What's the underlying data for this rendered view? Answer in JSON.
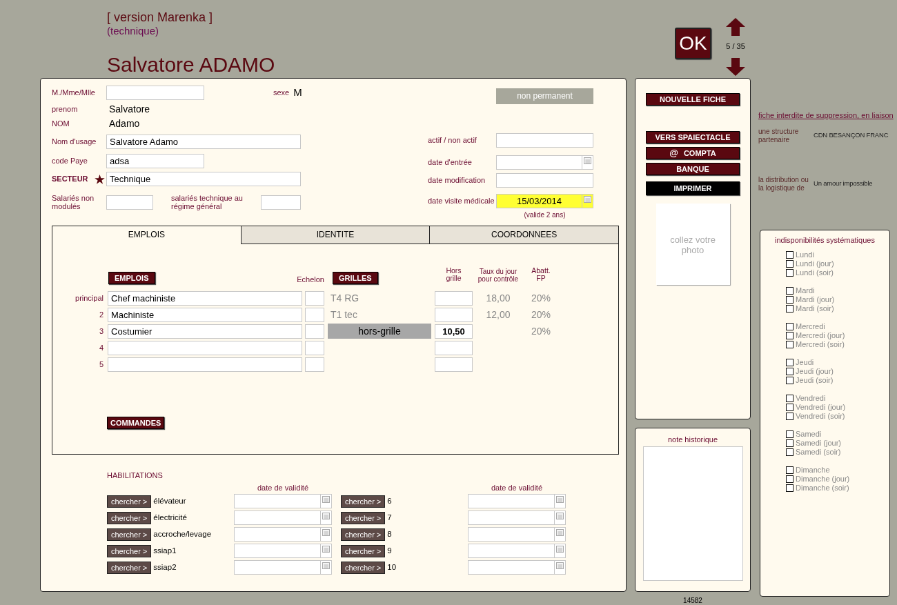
{
  "header": {
    "version": "[ version Marenka ]",
    "subtitle": "(technique)",
    "name": "Salvatore ADAMO",
    "ok_button": "OK",
    "record_counter": "5 / 35"
  },
  "identity": {
    "civility": {
      "label": "M./Mme/Mlle"
    },
    "sexe": {
      "label": "sexe",
      "value": "M"
    },
    "prenom": {
      "label": "prenom",
      "value": "Salvatore"
    },
    "nom": {
      "label": "NOM",
      "value": "Adamo"
    },
    "nom_usage": {
      "label": "Nom d'usage",
      "value": "Salvatore Adamo"
    },
    "code_paye": {
      "label": "code Paye",
      "value": "adsa"
    },
    "secteur": {
      "label": "SECTEUR",
      "value": "Technique",
      "required": true
    },
    "non_modules": {
      "label": "Salariés non modulés"
    },
    "regime_general": {
      "label": "salariés technique au régime général"
    }
  },
  "status": {
    "badge": "non permanent",
    "actif": {
      "label": "actif / non actif"
    },
    "date_entree": {
      "label": "date d'entrée"
    },
    "date_modification": {
      "label": "date modification"
    },
    "visite_medicale": {
      "label": "date visite médicale",
      "value": "15/03/2014",
      "highlighted": true,
      "note": "(valide 2 ans)"
    }
  },
  "tabs": [
    {
      "label": "EMPLOIS",
      "selected": true
    },
    {
      "label": "IDENTITE",
      "selected": false
    },
    {
      "label": "COORDONNEES",
      "selected": false
    }
  ],
  "emplois": {
    "emplois_button": "EMPLOIS",
    "grilles_button": "GRILLES",
    "commandes_button": "COMMANDES",
    "columns": {
      "echelon": "Echelon",
      "hors_grille": "Hors grille",
      "taux": "Taux du jour pour contrôle",
      "abatt": "Abatt. FP"
    },
    "rows": [
      {
        "index": "principal",
        "job": "Chef machiniste",
        "grille": "T4 RG",
        "off_grid": false,
        "taux": "18,00",
        "abatt": "20%"
      },
      {
        "index": "2",
        "job": "Machiniste",
        "grille": "T1 tec",
        "off_grid": false,
        "taux": "12,00",
        "abatt": "20%"
      },
      {
        "index": "3",
        "job": "Costumier",
        "grille": "hors-grille",
        "off_grid": true,
        "hors_grille": "10,50",
        "abatt": "20%"
      },
      {
        "index": "4"
      },
      {
        "index": "5"
      }
    ]
  },
  "habilitations": {
    "title": "HABILITATIONS",
    "date_headers": [
      "date de validité",
      "date de validité"
    ],
    "items": [
      {
        "button": "chercher >",
        "label": "élévateur"
      },
      {
        "button": "chercher >",
        "label": "6"
      },
      {
        "button": "chercher >",
        "label": "électricité"
      },
      {
        "button": "chercher >",
        "label": "7"
      },
      {
        "button": "chercher >",
        "label": "accroche/levage"
      },
      {
        "button": "chercher >",
        "label": "8"
      },
      {
        "button": "chercher >",
        "label": "ssiap1"
      },
      {
        "button": "chercher >",
        "label": "9"
      },
      {
        "button": "chercher >",
        "label": "ssiap2"
      },
      {
        "button": "chercher >",
        "label": "10"
      }
    ]
  },
  "actions": [
    {
      "label": "NOUVELLE FICHE",
      "kind": "primary"
    },
    {
      "label": "VERS SPAIECTACLE",
      "kind": "primary"
    },
    {
      "label": "COMPTA",
      "kind": "primary",
      "icon": "@"
    },
    {
      "label": "BANQUE",
      "kind": "primary"
    },
    {
      "label": "IMPRIMER",
      "kind": "print"
    }
  ],
  "photo": {
    "placeholder": "collez votre photo"
  },
  "note": {
    "title": "note historique"
  },
  "record_id": "14582",
  "links": {
    "warning": "fiche interdite de suppression, en liaison",
    "items": [
      {
        "label": "une structure partenaire",
        "value": "CDN BESANÇON FRANC"
      },
      {
        "label": "la distribution ou la logistique de",
        "value": "Un amour impossible"
      }
    ]
  },
  "indisponibilites": {
    "title": "indisponibilités systématiques",
    "groups": [
      {
        "items": [
          {
            "label": "Lundi",
            "checked": false
          },
          {
            "label": "Lundi (jour)",
            "checked": false
          },
          {
            "label": "Lundi (soir)",
            "checked": false
          }
        ]
      },
      {
        "items": [
          {
            "label": "Mardi",
            "checked": false
          },
          {
            "label": "Mardi (jour)",
            "checked": false
          },
          {
            "label": "Mardi (soir)",
            "checked": false
          }
        ]
      },
      {
        "items": [
          {
            "label": "Mercredi",
            "checked": false
          },
          {
            "label": "Mercredi (jour)",
            "checked": false
          },
          {
            "label": "Mercredi (soir)",
            "checked": false
          }
        ]
      },
      {
        "items": [
          {
            "label": "Jeudi",
            "checked": false
          },
          {
            "label": "Jeudi (jour)",
            "checked": false
          },
          {
            "label": "Jeudi (soir)",
            "checked": false
          }
        ]
      },
      {
        "items": [
          {
            "label": "Vendredi",
            "checked": false
          },
          {
            "label": "Vendredi (jour)",
            "checked": false
          },
          {
            "label": "Vendredi (soir)",
            "checked": false
          }
        ]
      },
      {
        "items": [
          {
            "label": "Samedi",
            "checked": false
          },
          {
            "label": "Samedi (jour)",
            "checked": false
          },
          {
            "label": "Samedi (soir)",
            "checked": false
          }
        ]
      },
      {
        "items": [
          {
            "label": "Dimanche",
            "checked": false
          },
          {
            "label": "Dimanche (jour)",
            "checked": false
          },
          {
            "label": "Dimanche (soir)",
            "checked": false
          }
        ]
      }
    ]
  }
}
